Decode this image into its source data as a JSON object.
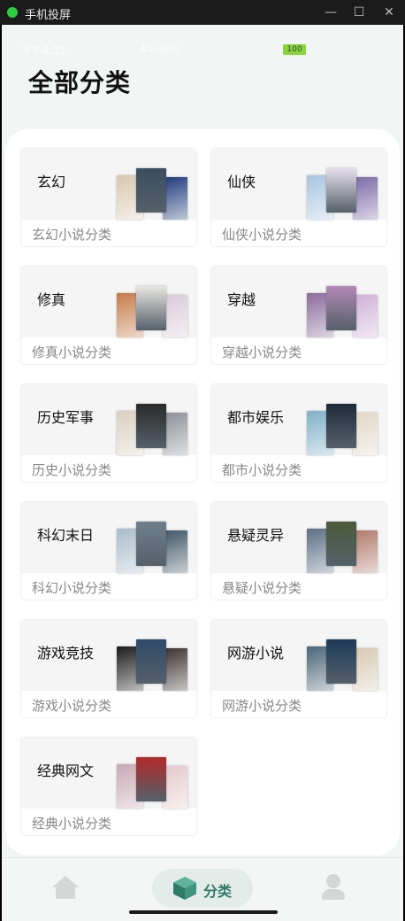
{
  "window": {
    "title": "手机投屏"
  },
  "status_bar": {
    "time": "下午4:21",
    "speed": "40.4K/s",
    "battery": "100"
  },
  "page": {
    "title": "全部分类"
  },
  "categories": [
    {
      "name": "玄幻",
      "subtitle": "玄幻小说分类",
      "covers": [
        "#d9c8b0",
        "#3a4d5e",
        "#1e3a7a"
      ]
    },
    {
      "name": "仙侠",
      "subtitle": "仙侠小说分类",
      "covers": [
        "#a8c4e0",
        "#e6e0ec",
        "#7a6aa6"
      ]
    },
    {
      "name": "修真",
      "subtitle": "修真小说分类",
      "covers": [
        "#c47a4a",
        "#e8e6e2",
        "#d9cbd8"
      ]
    },
    {
      "name": "穿越",
      "subtitle": "穿越小说分类",
      "covers": [
        "#8a6a9a",
        "#b388b8",
        "#cfb0d8"
      ]
    },
    {
      "name": "历史军事",
      "subtitle": "历史小说分类",
      "covers": [
        "#d8d0c0",
        "#2a2a2a",
        "#8b8f94"
      ]
    },
    {
      "name": "都市娱乐",
      "subtitle": "都市小说分类",
      "covers": [
        "#7fb0c8",
        "#1e2a3a",
        "#e2d6c6"
      ]
    },
    {
      "name": "科幻末日",
      "subtitle": "科幻小说分类",
      "covers": [
        "#a9bccb",
        "#6f7f8f",
        "#3f5564"
      ]
    },
    {
      "name": "悬疑灵异",
      "subtitle": "悬疑小说分类",
      "covers": [
        "#5a6e84",
        "#4a5a3a",
        "#b07a6a"
      ]
    },
    {
      "name": "游戏竞技",
      "subtitle": "游戏小说分类",
      "covers": [
        "#1a1a1a",
        "#304a6a",
        "#3a3030"
      ]
    },
    {
      "name": "网游小说",
      "subtitle": "网游小说分类",
      "covers": [
        "#4a6478",
        "#1c3a5a",
        "#d6c8b0"
      ]
    },
    {
      "name": "经典网文",
      "subtitle": "经典小说分类",
      "covers": [
        "#c8a8b4",
        "#b02a2a",
        "#e4c8cc"
      ]
    }
  ],
  "bottom_nav": {
    "home_icon": "home-icon",
    "category_label": "分类",
    "category_icon": "cube-icon",
    "profile_icon": "person-icon",
    "accent": "#2e7b67"
  }
}
